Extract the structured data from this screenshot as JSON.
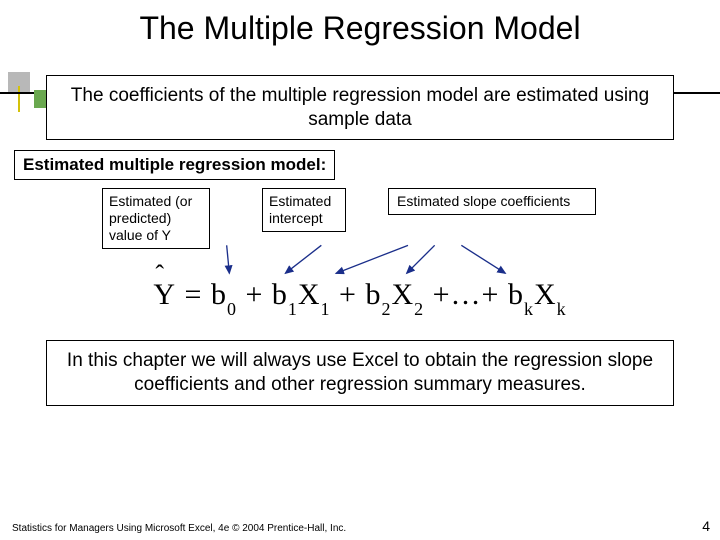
{
  "title": "The Multiple Regression Model",
  "intro": "The coefficients of the multiple regression model are estimated using sample data",
  "section_label": "Estimated multiple regression model:",
  "labels": {
    "yhat": "Estimated (or predicted) value of Y",
    "intercept": "Estimated intercept",
    "slopes": "Estimated slope coefficients"
  },
  "equation": {
    "lhs": "Y",
    "eq": "=",
    "terms": [
      "b",
      "+ b",
      "X",
      "+ b",
      "X",
      "+…+ b",
      "X"
    ],
    "subs": [
      "0",
      "1",
      "1",
      "2",
      "2",
      "k",
      "k"
    ]
  },
  "note": "In this chapter we will always use Excel to obtain the regression slope coefficients and other regression summary measures.",
  "footer": "Statistics for Managers Using Microsoft Excel, 4e © 2004 Prentice-Hall, Inc.",
  "page": "4"
}
